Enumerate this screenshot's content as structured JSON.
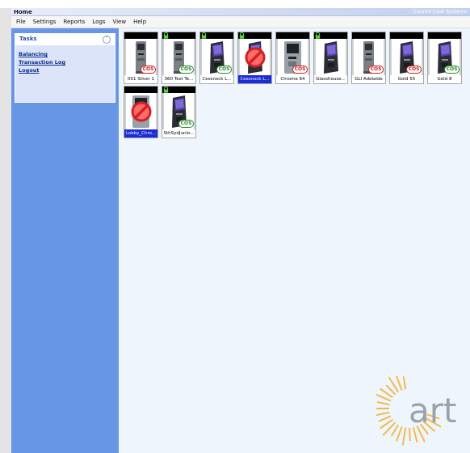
{
  "window": {
    "title": "Home",
    "brand": "Count4 Cash Systems"
  },
  "menu": [
    "File",
    "Settings",
    "Reports",
    "Logs",
    "View",
    "Help"
  ],
  "tasks": {
    "header": "Tasks",
    "links": [
      "Balancing",
      "Transaction Log",
      "Logout"
    ]
  },
  "machines": [
    {
      "name": "001 Silver 1",
      "model": "silver",
      "badge": "COS",
      "badge_color": "red",
      "locked": false,
      "disabled": false,
      "selected": false
    },
    {
      "name": "360 Test Te...",
      "model": "silver",
      "badge": "COS",
      "badge_color": "green",
      "locked": true,
      "disabled": false,
      "selected": false
    },
    {
      "name": "Cessnock L...",
      "model": "kiosk",
      "badge": "COS",
      "badge_color": "green",
      "locked": true,
      "disabled": false,
      "selected": false
    },
    {
      "name": "Cessnock L...",
      "model": "kiosk",
      "badge": "",
      "badge_color": "",
      "locked": true,
      "disabled": true,
      "selected": true
    },
    {
      "name": "Chrome 64",
      "model": "chrome",
      "badge": "COS",
      "badge_color": "red",
      "locked": false,
      "disabled": false,
      "selected": false
    },
    {
      "name": "Glasshouse...",
      "model": "kiosk",
      "badge": "",
      "badge_color": "",
      "locked": true,
      "disabled": false,
      "selected": false
    },
    {
      "name": "GLI Adelaide",
      "model": "silver",
      "badge": "COS",
      "badge_color": "red",
      "locked": false,
      "disabled": false,
      "selected": false
    },
    {
      "name": "Gold 55",
      "model": "kiosk",
      "badge": "COS",
      "badge_color": "red",
      "locked": false,
      "disabled": false,
      "selected": false
    },
    {
      "name": "Gold 8",
      "model": "kiosk",
      "badge": "COS",
      "badge_color": "green",
      "locked": false,
      "disabled": false,
      "selected": false
    },
    {
      "name": "Lobby_Chro...",
      "model": "chrome",
      "badge": "",
      "badge_color": "",
      "locked": false,
      "disabled": true,
      "selected": true
    },
    {
      "name": "SthSydJunio...",
      "model": "kiosk",
      "badge": "COS",
      "badge_color": "green",
      "locked": true,
      "disabled": false,
      "selected": false
    }
  ],
  "logo": {
    "text": "art",
    "color": "#f4b43a"
  }
}
